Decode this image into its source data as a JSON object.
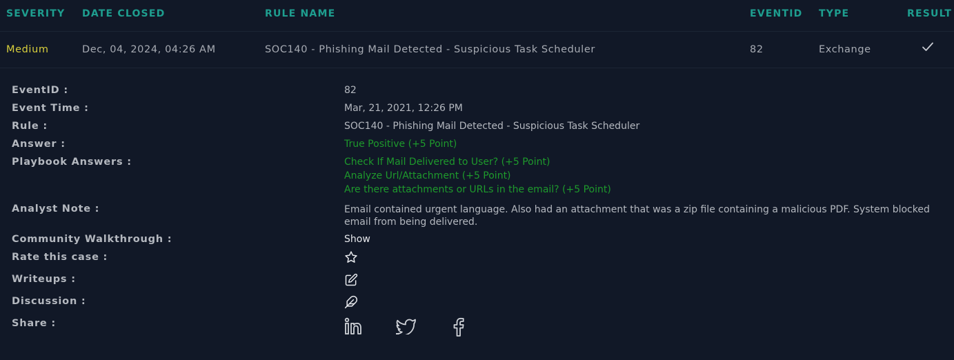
{
  "headers": {
    "severity": "SEVERITY",
    "date_closed": "DATE CLOSED",
    "rule_name": "RULE NAME",
    "eventid": "EVENTID",
    "type": "TYPE",
    "result": "RESULT"
  },
  "row": {
    "severity": "Medium",
    "date_closed": "Dec, 04, 2024, 04:26 AM",
    "rule_name": "SOC140 - Phishing Mail Detected - Suspicious Task Scheduler",
    "eventid": "82",
    "type": "Exchange",
    "result_icon": "check-icon"
  },
  "details": {
    "eventid_label": "EventID :",
    "eventid_value": "82",
    "event_time_label": "Event Time :",
    "event_time_value": "Mar, 21, 2021, 12:26 PM",
    "rule_label": "Rule :",
    "rule_value": "SOC140 - Phishing Mail Detected - Suspicious Task Scheduler",
    "answer_label": "Answer :",
    "answer_value": "True Positive (+5 Point)",
    "playbook_label": "Playbook Answers :",
    "playbook_answers": [
      "Check If Mail Delivered to User? (+5 Point)",
      "Analyze Url/Attachment (+5 Point)",
      "Are there attachments or URLs in the email? (+5 Point)"
    ],
    "analyst_note_label": "Analyst Note :",
    "analyst_note_value": "Email contained urgent language. Also had an attachment that was a zip file containing a malicious PDF. System blocked email from being delivered.",
    "community_label": "Community Walkthrough :",
    "community_value": "Show",
    "rate_label": "Rate this case :",
    "rate_icon": "star-icon",
    "writeups_label": "Writeups :",
    "writeups_icon": "edit-icon",
    "discussion_label": "Discussion :",
    "discussion_icon": "feather-icon",
    "share_label": "Share :",
    "share_icons": [
      "linkedin-icon",
      "twitter-icon",
      "facebook-icon"
    ]
  },
  "colors": {
    "background": "#111827",
    "header_text": "#1e9e8f",
    "severity_medium": "#d8cf3c",
    "answer_green": "#1e9a2c",
    "label_text": "#b4b8bf"
  }
}
